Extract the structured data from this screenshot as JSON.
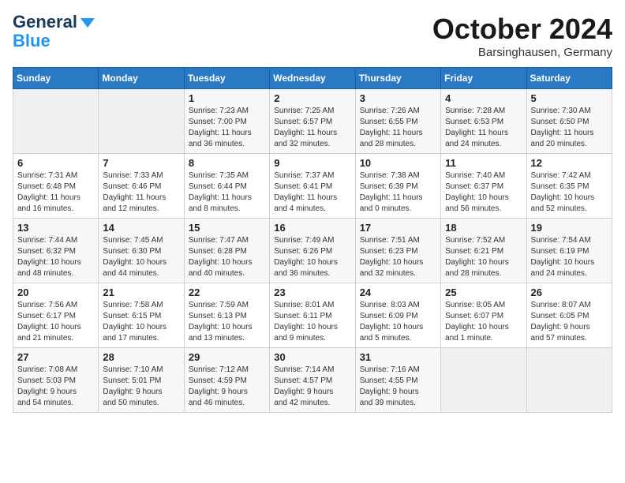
{
  "header": {
    "logo_line1": "General",
    "logo_line2": "Blue",
    "month_title": "October 2024",
    "location": "Barsinghausen, Germany"
  },
  "weekdays": [
    "Sunday",
    "Monday",
    "Tuesday",
    "Wednesday",
    "Thursday",
    "Friday",
    "Saturday"
  ],
  "weeks": [
    [
      {
        "day": "",
        "info": ""
      },
      {
        "day": "",
        "info": ""
      },
      {
        "day": "1",
        "info": "Sunrise: 7:23 AM\nSunset: 7:00 PM\nDaylight: 11 hours\nand 36 minutes."
      },
      {
        "day": "2",
        "info": "Sunrise: 7:25 AM\nSunset: 6:57 PM\nDaylight: 11 hours\nand 32 minutes."
      },
      {
        "day": "3",
        "info": "Sunrise: 7:26 AM\nSunset: 6:55 PM\nDaylight: 11 hours\nand 28 minutes."
      },
      {
        "day": "4",
        "info": "Sunrise: 7:28 AM\nSunset: 6:53 PM\nDaylight: 11 hours\nand 24 minutes."
      },
      {
        "day": "5",
        "info": "Sunrise: 7:30 AM\nSunset: 6:50 PM\nDaylight: 11 hours\nand 20 minutes."
      }
    ],
    [
      {
        "day": "6",
        "info": "Sunrise: 7:31 AM\nSunset: 6:48 PM\nDaylight: 11 hours\nand 16 minutes."
      },
      {
        "day": "7",
        "info": "Sunrise: 7:33 AM\nSunset: 6:46 PM\nDaylight: 11 hours\nand 12 minutes."
      },
      {
        "day": "8",
        "info": "Sunrise: 7:35 AM\nSunset: 6:44 PM\nDaylight: 11 hours\nand 8 minutes."
      },
      {
        "day": "9",
        "info": "Sunrise: 7:37 AM\nSunset: 6:41 PM\nDaylight: 11 hours\nand 4 minutes."
      },
      {
        "day": "10",
        "info": "Sunrise: 7:38 AM\nSunset: 6:39 PM\nDaylight: 11 hours\nand 0 minutes."
      },
      {
        "day": "11",
        "info": "Sunrise: 7:40 AM\nSunset: 6:37 PM\nDaylight: 10 hours\nand 56 minutes."
      },
      {
        "day": "12",
        "info": "Sunrise: 7:42 AM\nSunset: 6:35 PM\nDaylight: 10 hours\nand 52 minutes."
      }
    ],
    [
      {
        "day": "13",
        "info": "Sunrise: 7:44 AM\nSunset: 6:32 PM\nDaylight: 10 hours\nand 48 minutes."
      },
      {
        "day": "14",
        "info": "Sunrise: 7:45 AM\nSunset: 6:30 PM\nDaylight: 10 hours\nand 44 minutes."
      },
      {
        "day": "15",
        "info": "Sunrise: 7:47 AM\nSunset: 6:28 PM\nDaylight: 10 hours\nand 40 minutes."
      },
      {
        "day": "16",
        "info": "Sunrise: 7:49 AM\nSunset: 6:26 PM\nDaylight: 10 hours\nand 36 minutes."
      },
      {
        "day": "17",
        "info": "Sunrise: 7:51 AM\nSunset: 6:23 PM\nDaylight: 10 hours\nand 32 minutes."
      },
      {
        "day": "18",
        "info": "Sunrise: 7:52 AM\nSunset: 6:21 PM\nDaylight: 10 hours\nand 28 minutes."
      },
      {
        "day": "19",
        "info": "Sunrise: 7:54 AM\nSunset: 6:19 PM\nDaylight: 10 hours\nand 24 minutes."
      }
    ],
    [
      {
        "day": "20",
        "info": "Sunrise: 7:56 AM\nSunset: 6:17 PM\nDaylight: 10 hours\nand 21 minutes."
      },
      {
        "day": "21",
        "info": "Sunrise: 7:58 AM\nSunset: 6:15 PM\nDaylight: 10 hours\nand 17 minutes."
      },
      {
        "day": "22",
        "info": "Sunrise: 7:59 AM\nSunset: 6:13 PM\nDaylight: 10 hours\nand 13 minutes."
      },
      {
        "day": "23",
        "info": "Sunrise: 8:01 AM\nSunset: 6:11 PM\nDaylight: 10 hours\nand 9 minutes."
      },
      {
        "day": "24",
        "info": "Sunrise: 8:03 AM\nSunset: 6:09 PM\nDaylight: 10 hours\nand 5 minutes."
      },
      {
        "day": "25",
        "info": "Sunrise: 8:05 AM\nSunset: 6:07 PM\nDaylight: 10 hours\nand 1 minute."
      },
      {
        "day": "26",
        "info": "Sunrise: 8:07 AM\nSunset: 6:05 PM\nDaylight: 9 hours\nand 57 minutes."
      }
    ],
    [
      {
        "day": "27",
        "info": "Sunrise: 7:08 AM\nSunset: 5:03 PM\nDaylight: 9 hours\nand 54 minutes."
      },
      {
        "day": "28",
        "info": "Sunrise: 7:10 AM\nSunset: 5:01 PM\nDaylight: 9 hours\nand 50 minutes."
      },
      {
        "day": "29",
        "info": "Sunrise: 7:12 AM\nSunset: 4:59 PM\nDaylight: 9 hours\nand 46 minutes."
      },
      {
        "day": "30",
        "info": "Sunrise: 7:14 AM\nSunset: 4:57 PM\nDaylight: 9 hours\nand 42 minutes."
      },
      {
        "day": "31",
        "info": "Sunrise: 7:16 AM\nSunset: 4:55 PM\nDaylight: 9 hours\nand 39 minutes."
      },
      {
        "day": "",
        "info": ""
      },
      {
        "day": "",
        "info": ""
      }
    ]
  ]
}
